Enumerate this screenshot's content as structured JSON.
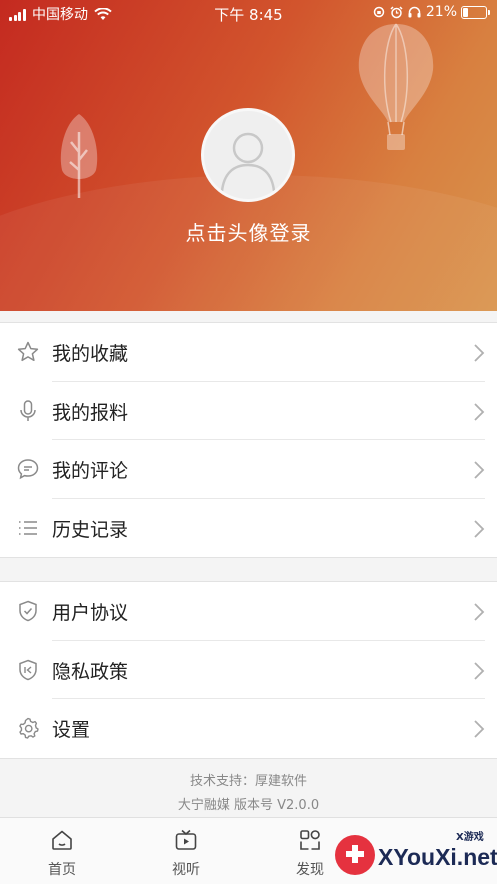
{
  "status_bar": {
    "carrier": "中国移动",
    "time": "下午 8:45",
    "battery": "21%",
    "battery_level": 0.21
  },
  "profile": {
    "login_prompt": "点击头像登录"
  },
  "menu_group_1": [
    {
      "label": "我的收藏",
      "icon": "star-icon"
    },
    {
      "label": "我的报料",
      "icon": "microphone-icon"
    },
    {
      "label": "我的评论",
      "icon": "comment-icon"
    },
    {
      "label": "历史记录",
      "icon": "list-icon"
    }
  ],
  "menu_group_2": [
    {
      "label": "用户协议",
      "icon": "shield-icon"
    },
    {
      "label": "隐私政策",
      "icon": "privacy-shield-icon"
    },
    {
      "label": "设置",
      "icon": "gear-icon"
    }
  ],
  "footer": {
    "tech_support": "技术支持：厚建软件",
    "version": "大宁融媒  版本号 V2.0.0"
  },
  "tabbar": [
    {
      "label": "首页",
      "icon": "home-icon"
    },
    {
      "label": "视听",
      "icon": "tv-icon"
    },
    {
      "label": "发现",
      "icon": "discover-icon"
    }
  ],
  "watermark": {
    "brand": "XYouXi.net",
    "tag": "X游戏"
  },
  "colors": {
    "header_start": "#c42a20",
    "header_end": "#d9944d",
    "icon_gray": "#8a8a8a"
  }
}
